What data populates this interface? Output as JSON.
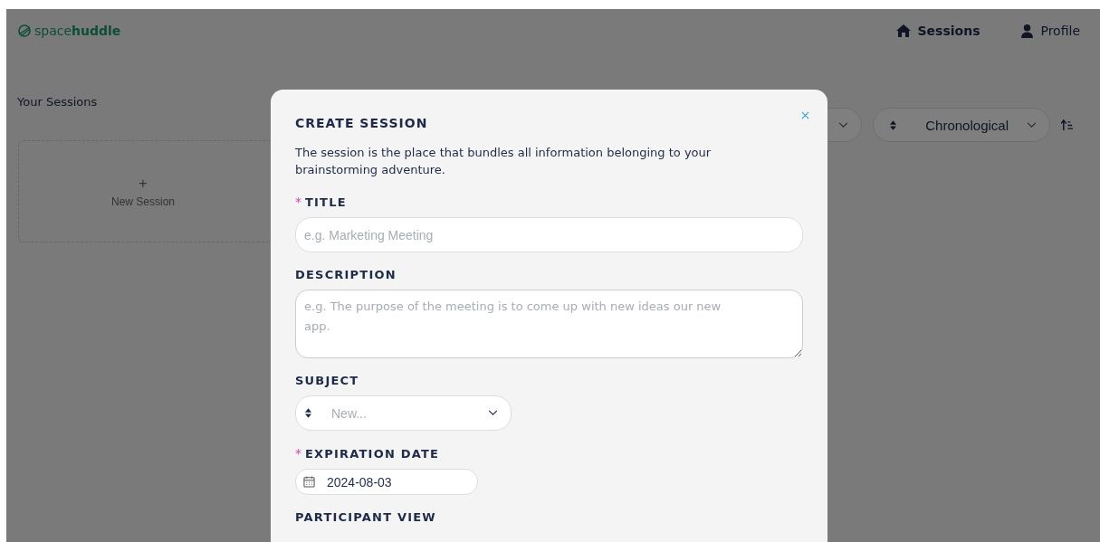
{
  "header": {
    "logo": "space**huddle**",
    "nav": [
      {
        "label": "Sessions",
        "kind": "home",
        "selected": true
      },
      {
        "label": "Profile",
        "kind": "person",
        "selected": false
      }
    ]
  },
  "page": {
    "title": "Your Sessions",
    "new_session": {
      "icon": "+",
      "label": "New Session"
    },
    "sort_select": {
      "value": "Chronological"
    }
  },
  "modal": {
    "title": "CREATE SESSION",
    "intro": "The session is the place that bundles all information belonging to your brainstorming adventure.",
    "fields": [
      {
        "kind": "text",
        "label": "TITLE",
        "required_mark": "*",
        "placeholder": "e.g. Marketing Meeting"
      },
      {
        "kind": "textarea",
        "label": "DESCRIPTION",
        "placeholder": "e.g. The purpose of the meeting is to come up with new ideas our new app."
      },
      {
        "kind": "select",
        "label": "SUBJECT",
        "placeholder": "New..."
      },
      {
        "kind": "date",
        "label": "EXPIRATION DATE",
        "required_mark": "*",
        "value": "2024-08-03"
      },
      {
        "kind": "heading",
        "label": "PARTICIPANT VIEW"
      }
    ]
  }
}
